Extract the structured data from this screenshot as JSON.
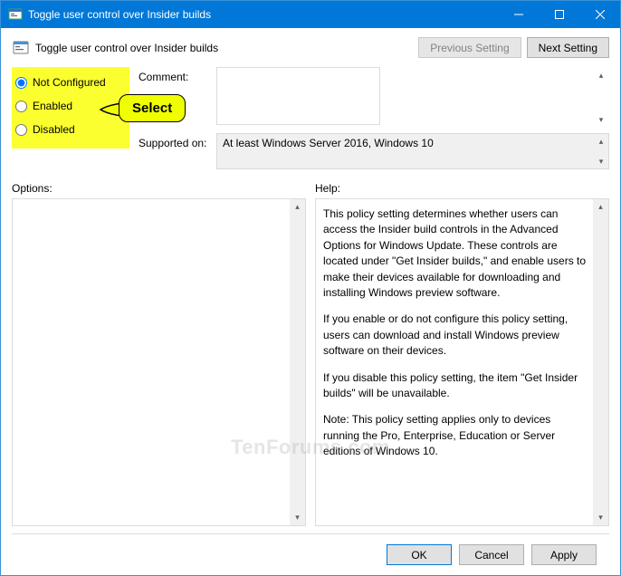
{
  "window": {
    "title": "Toggle user control over Insider builds"
  },
  "header": {
    "title": "Toggle user control over Insider builds",
    "prev_setting": "Previous Setting",
    "next_setting": "Next Setting"
  },
  "radios": {
    "not_configured": "Not Configured",
    "enabled": "Enabled",
    "disabled": "Disabled",
    "selected": "not_configured"
  },
  "callout": {
    "label": "Select"
  },
  "fields": {
    "comment_label": "Comment:",
    "comment_value": "",
    "supported_label": "Supported on:",
    "supported_value": "At least Windows Server 2016, Windows 10"
  },
  "columns": {
    "options_label": "Options:",
    "help_label": "Help:"
  },
  "help": {
    "p1": "This policy setting determines whether users can access the Insider build controls in the Advanced Options for Windows Update. These controls are located under \"Get Insider builds,\" and enable users to make their devices available for downloading and installing Windows preview software.",
    "p2": "If you enable or do not configure this policy setting, users can download and install Windows preview software on their devices.",
    "p3": "If you disable this policy setting, the item \"Get Insider builds\" will be unavailable.",
    "p4": "Note: This policy setting applies only to devices running the Pro, Enterprise, Education or Server editions of Windows 10."
  },
  "footer": {
    "ok": "OK",
    "cancel": "Cancel",
    "apply": "Apply"
  },
  "watermark": "TenForums.com"
}
